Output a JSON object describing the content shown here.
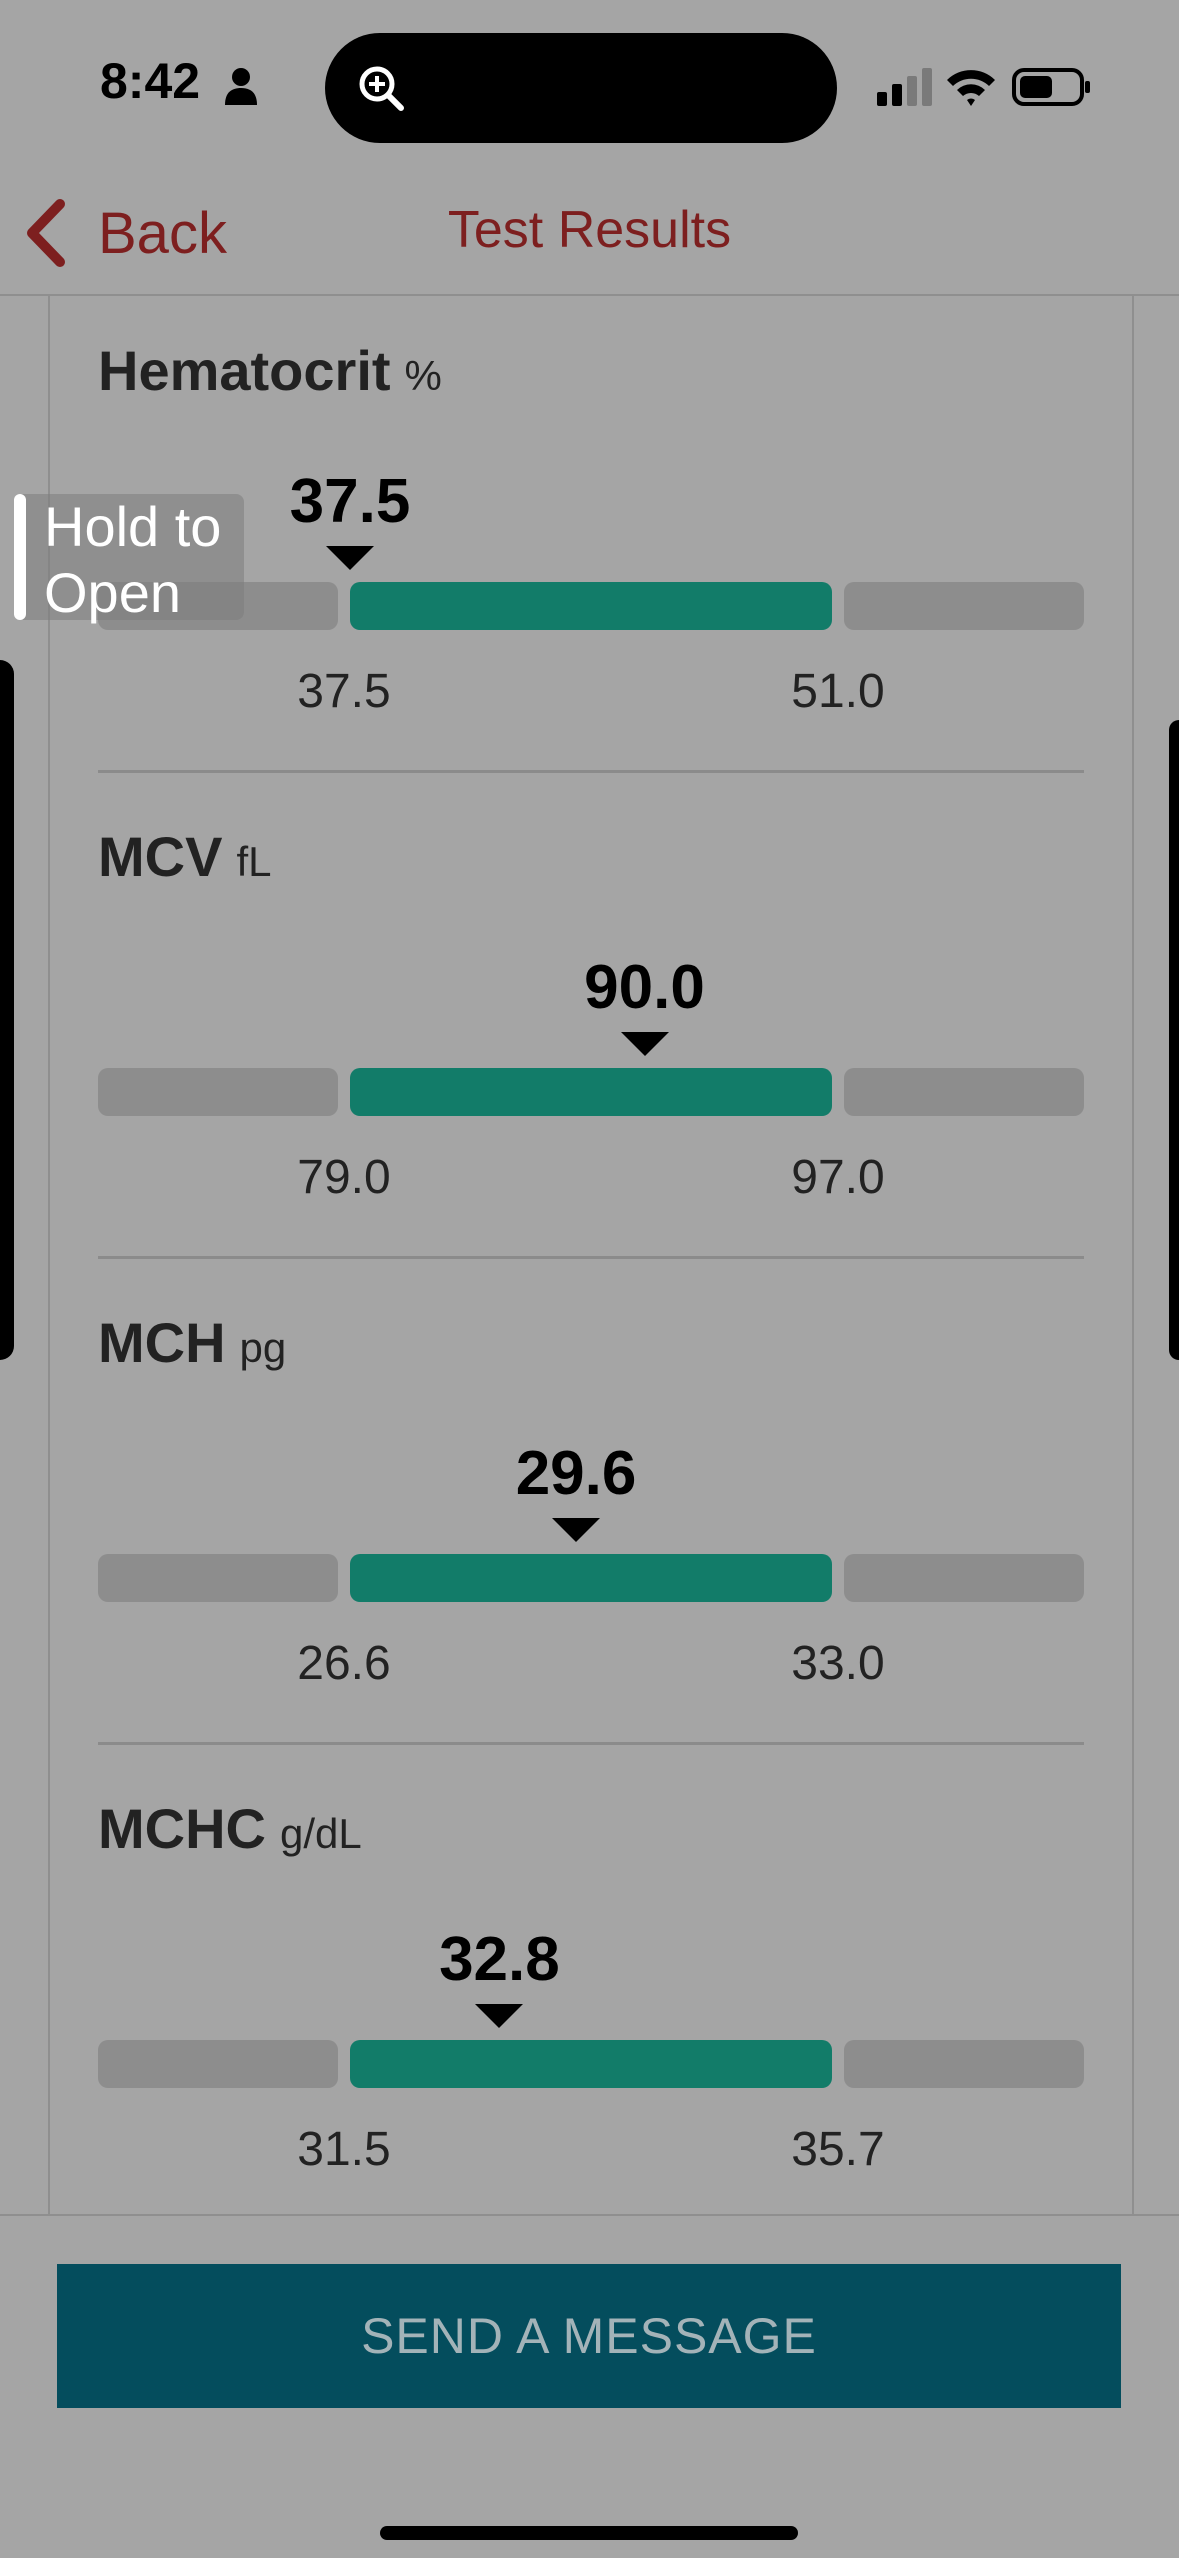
{
  "status_bar": {
    "time": "8:42"
  },
  "nav": {
    "back_label": "Back",
    "title": "Test Results"
  },
  "overlay": {
    "line1": "Hold to",
    "line2": "Open"
  },
  "results": [
    {
      "name": "Hematocrit",
      "unit": "%",
      "value": "37.5",
      "low": "37.5",
      "high": "51.0",
      "marker_fraction": 0.0
    },
    {
      "name": "MCV",
      "unit": "fL",
      "value": "90.0",
      "low": "79.0",
      "high": "97.0",
      "marker_fraction": 0.611
    },
    {
      "name": "MCH",
      "unit": "pg",
      "value": "29.6",
      "low": "26.6",
      "high": "33.0",
      "marker_fraction": 0.469
    },
    {
      "name": "MCHC",
      "unit": "g/dL",
      "value": "32.8",
      "low": "31.5",
      "high": "35.7",
      "marker_fraction": 0.31
    }
  ],
  "footer": {
    "send_label": "SEND A MESSAGE"
  },
  "colors": {
    "accent": "#7d1f1f",
    "normal_range": "#127c69",
    "button": "#044d5d",
    "out_of_range": "#8d8d8d"
  }
}
